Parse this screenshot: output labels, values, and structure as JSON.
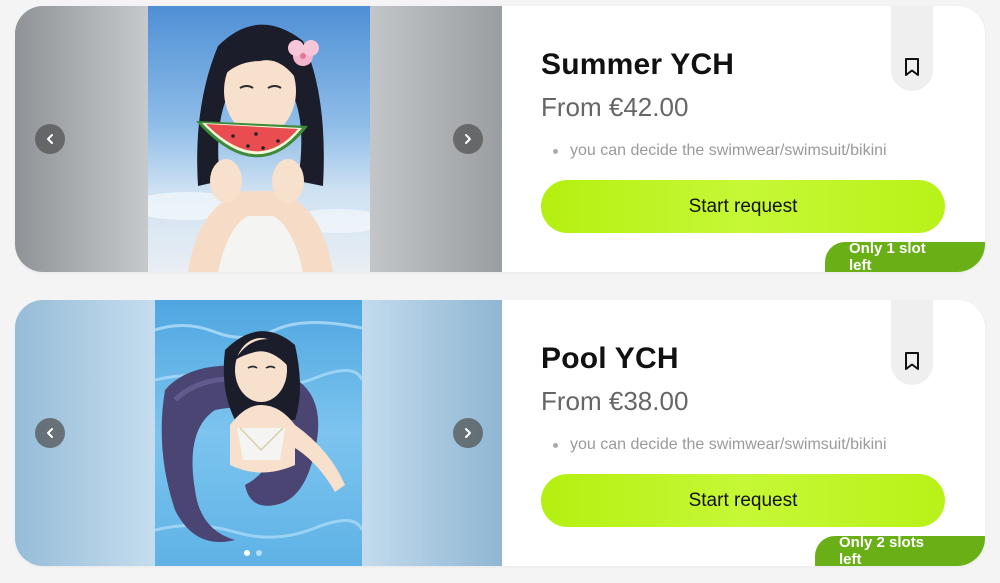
{
  "products": [
    {
      "title": "Summer YCH",
      "price": "From €42.00",
      "features": [
        "you can decide the swimwear/swimsuit/bikini"
      ],
      "cta_label": "Start request",
      "slots_badge": "Only 1 slot left",
      "gallery": {
        "image_count": 1,
        "active_index": 0
      }
    },
    {
      "title": "Pool YCH",
      "price": "From €38.00",
      "features": [
        "you can decide the swimwear/swimsuit/bikini"
      ],
      "cta_label": "Start request",
      "slots_badge": "Only 2 slots left",
      "gallery": {
        "image_count": 2,
        "active_index": 0
      }
    }
  ],
  "icons": {
    "prev": "chevron-left-icon",
    "next": "chevron-right-icon",
    "bookmark": "bookmark-icon"
  },
  "colors": {
    "cta": "#b8f218",
    "badge": "#69b017",
    "title": "#111111",
    "price": "#666666"
  }
}
